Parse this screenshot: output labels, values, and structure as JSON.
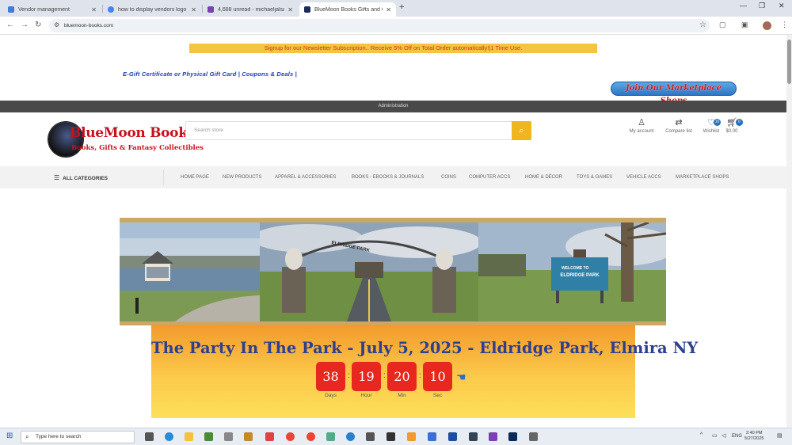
{
  "browser": {
    "tabs": [
      {
        "title": "Vendor management",
        "favicon_color": "#3b7dd8"
      },
      {
        "title": "how to display vendors logo o",
        "favicon_color": "#4285f4"
      },
      {
        "title": "4,688 unread - michaeljalsar@y",
        "favicon_color": "#7b3fb8"
      },
      {
        "title": "BlueMoon Books Gifts and Co",
        "favicon_color": "#1b2a5a",
        "active": true
      }
    ],
    "new_tab": "+",
    "url": "bluemoon-books.com"
  },
  "site": {
    "promo": "Signup for our Newsletter Subscription.. Receive 5% Off on Total Order automatically!|1 Time Use.",
    "gift_links": "E-Gift Certificate or Physical Gift Card | Coupons & Deals |",
    "marketplace_button": "Join Our Marketplace Shops",
    "admin_bar": "Administration",
    "logo": {
      "line1": "BlueMoon Books",
      "line2": "Books, Gifts & Fantasy Collectibles"
    },
    "search_placeholder": "Search store",
    "header_icons": {
      "account": "My account",
      "compare": "Compare list",
      "wishlist": "Wishlist",
      "wishlist_count": "10",
      "cart_total": "$0.00",
      "cart_count": "0"
    },
    "nav": {
      "all_categories": "ALL CATEGORIES",
      "items": [
        "HOME PAGE",
        "NEW PRODUCTS",
        "APPAREL & ACCESSORIES",
        "BOOKS - EBOOKS & JOURNALS",
        "COINS",
        "COMPUTER ACCS",
        "HOME & DÉCOR",
        "TOYS & GAMES",
        "VEHICLE ACCS",
        "MARKETPLACE SHOPS"
      ]
    },
    "banner": {
      "sign_text": "ELDRIDGE PARK",
      "sign_top": "WELCOME TO"
    },
    "event": {
      "title": "The Party In The Park - July 5, 2025 - Eldridge Park, Elmira NY",
      "countdown": [
        {
          "value": "38",
          "label": "Days"
        },
        {
          "value": "19",
          "label": "Hour"
        },
        {
          "value": "20",
          "label": "Min"
        },
        {
          "value": "10",
          "label": "Sec"
        }
      ]
    }
  },
  "taskbar": {
    "search_placeholder": "Type here to search",
    "tray_lang": "ENG",
    "time": "2:40 PM",
    "date": "5/27/2025"
  }
}
